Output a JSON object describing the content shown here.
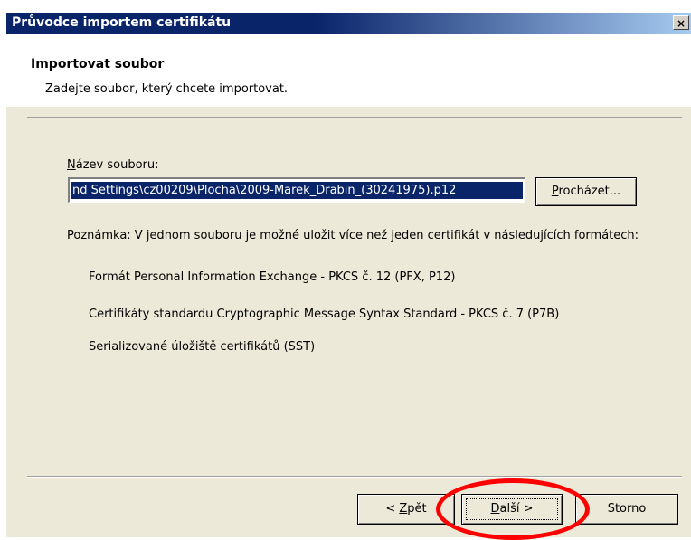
{
  "window": {
    "title": "Průvodce importem certifikátu",
    "close_icon_text": "×"
  },
  "header": {
    "title": "Importovat soubor",
    "subtitle": "Zadejte soubor, který chcete importovat."
  },
  "file_field": {
    "label_accel": "N",
    "label_rest": "ázev souboru:",
    "value": "nd Settings\\cz00209\\Plocha\\2009-Marek_Drabin_(30241975).p12",
    "browse_accel": "P",
    "browse_rest": "rocházet..."
  },
  "note": {
    "text": "Poznámka: V jednom souboru je možné uložit více než jeden certifikát v následujících formátech:",
    "formats": [
      "Formát Personal Information Exchange - PKCS č. 12 (PFX, P12)",
      "Certifikáty standardu Cryptographic Message Syntax Standard - PKCS č. 7 (P7B)",
      "Serializované úložiště certifikátů (SST)"
    ]
  },
  "buttons": {
    "back_prefix": "< ",
    "back_accel": "Z",
    "back_rest": "pět",
    "next_accel": "D",
    "next_rest": "alší >",
    "cancel": "Storno"
  },
  "colors": {
    "title_active": "#0a246a",
    "dialog_bg": "#ece9d8",
    "highlight_ring": "#ff0000"
  }
}
